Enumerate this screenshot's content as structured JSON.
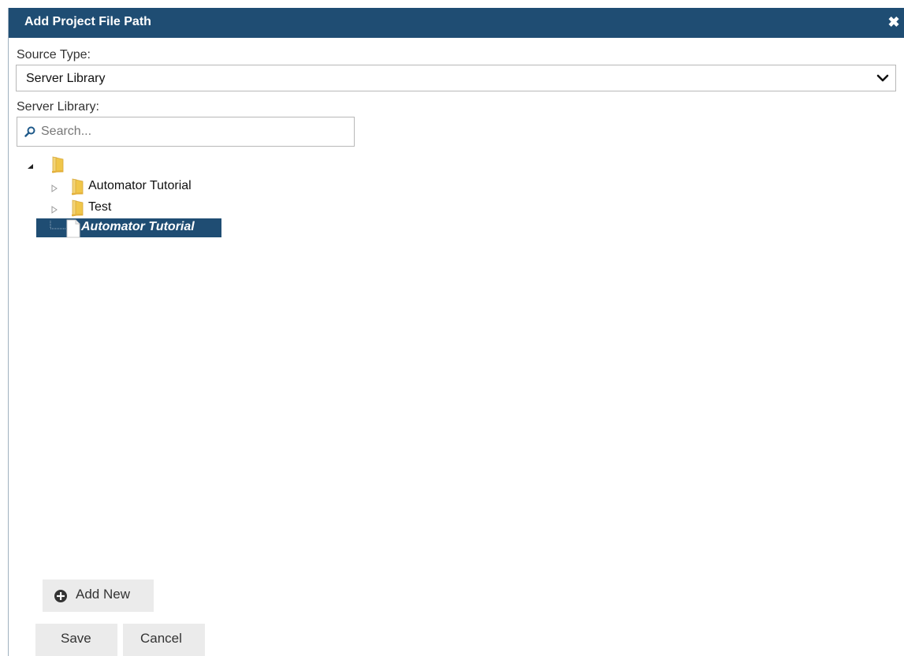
{
  "dialog": {
    "title": "Add Project File Path",
    "close_glyph": "✖"
  },
  "form": {
    "source_type_label": "Source Type:",
    "source_type_value": "Server Library",
    "server_library_label": "Server Library:",
    "search_placeholder": "Search...",
    "search_value": ""
  },
  "tree": {
    "root": {
      "label": "",
      "icon": "folder-icon",
      "expanded": true
    },
    "items": [
      {
        "label": "Automator Tutorial",
        "icon": "folder-icon",
        "type": "folder",
        "expanded": false
      },
      {
        "label": "Test",
        "icon": "folder-icon",
        "type": "folder",
        "expanded": false
      },
      {
        "label": "Automator Tutorial",
        "icon": "file-icon",
        "type": "file",
        "selected": true
      }
    ]
  },
  "actions": {
    "add_new_label": "Add New",
    "save_label": "Save",
    "cancel_label": "Cancel"
  },
  "colors": {
    "titlebar": "#1f4d73",
    "selection": "#1f4d73",
    "button_bg": "#ebebeb",
    "folder": "#f0c64a"
  }
}
